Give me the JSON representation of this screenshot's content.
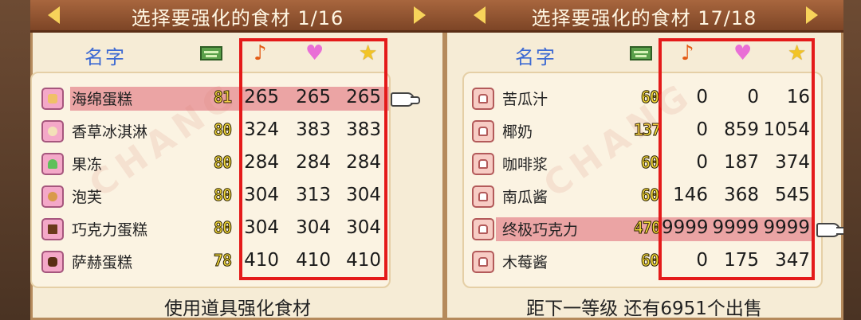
{
  "left": {
    "title": "选择要强化的食材 1/16",
    "header_name": "名字",
    "footer": "使用道具强化食材",
    "items": [
      {
        "name": "海绵蛋糕",
        "level": "81",
        "taste": "265",
        "fame": "265",
        "star": "265",
        "icon": "sponge-cake-icon",
        "color": "#f0c068"
      },
      {
        "name": "香草冰淇淋",
        "level": "80",
        "taste": "324",
        "fame": "383",
        "star": "383",
        "icon": "vanilla-ice-cream-icon",
        "color": "#f3e0b8"
      },
      {
        "name": "果冻",
        "level": "80",
        "taste": "284",
        "fame": "284",
        "star": "284",
        "icon": "jelly-icon",
        "color": "#5ec05a"
      },
      {
        "name": "泡芙",
        "level": "80",
        "taste": "304",
        "fame": "313",
        "star": "304",
        "icon": "cream-puff-icon",
        "color": "#d99a4a"
      },
      {
        "name": "巧克力蛋糕",
        "level": "80",
        "taste": "304",
        "fame": "304",
        "star": "304",
        "icon": "chocolate-cake-icon",
        "color": "#6b3a1c"
      },
      {
        "name": "萨赫蛋糕",
        "level": "78",
        "taste": "410",
        "fame": "410",
        "star": "410",
        "icon": "sacher-torte-icon",
        "color": "#5a2e14"
      }
    ],
    "selected_index": 0
  },
  "right": {
    "title": "选择要强化的食材 17/18",
    "header_name": "名字",
    "footer": "距下一等级 还有6951个出售",
    "items": [
      {
        "name": "苦瓜汁",
        "level": "60",
        "taste": "0",
        "fame": "0",
        "star": "16",
        "icon": "jar-icon"
      },
      {
        "name": "椰奶",
        "level": "137",
        "taste": "0",
        "fame": "859",
        "star": "1054",
        "icon": "jar-icon"
      },
      {
        "name": "咖啡浆",
        "level": "60",
        "taste": "0",
        "fame": "187",
        "star": "374",
        "icon": "jar-icon"
      },
      {
        "name": "南瓜酱",
        "level": "60",
        "taste": "146",
        "fame": "368",
        "star": "545",
        "icon": "jar-icon"
      },
      {
        "name": "终极巧克力",
        "level": "470",
        "taste": "9999",
        "fame": "9999",
        "star": "9999",
        "icon": "jar-icon"
      },
      {
        "name": "木莓酱",
        "level": "60",
        "taste": "0",
        "fame": "175",
        "star": "347",
        "icon": "jar-icon"
      }
    ],
    "selected_index": 4
  },
  "icons": {
    "taste": "♪",
    "fame": "♥",
    "star": "★"
  },
  "colors": {
    "title_bar": "#8e5230",
    "highlight": "#eba4a4",
    "annotation_box": "#e41a1a",
    "header_name": "#3d6ad3"
  }
}
